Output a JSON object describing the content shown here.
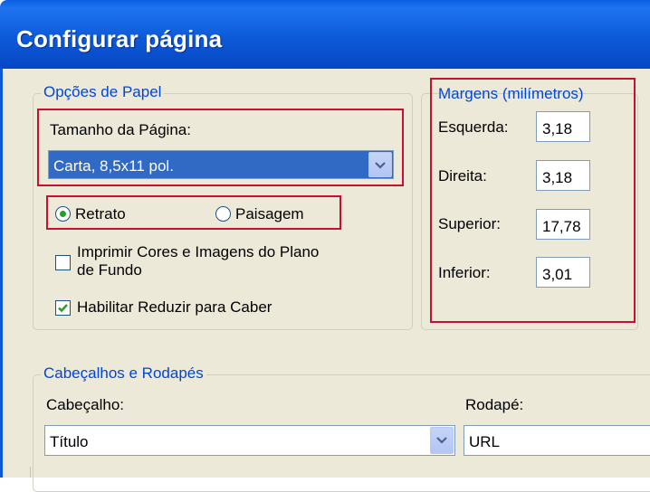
{
  "dialog": {
    "title": "Configurar página"
  },
  "paper_options": {
    "legend": "Opções de Papel",
    "page_size_label": "Tamanho da Página:",
    "page_size_value": "Carta, 8,5x11 pol.",
    "orientation": {
      "portrait_label": "Retrato",
      "landscape_label": "Paisagem",
      "selected": "Retrato"
    },
    "print_background": {
      "label_line1": "Imprimir Cores e Imagens do Plano",
      "label_line2": "de Fundo",
      "checked": false
    },
    "shrink_to_fit": {
      "label": "Habilitar Reduzir para Caber",
      "checked": true
    }
  },
  "margins": {
    "legend": "Margens (milímetros)",
    "left": {
      "label": "Esquerda:",
      "value": "3,18"
    },
    "right": {
      "label": "Direita:",
      "value": "3,18"
    },
    "top": {
      "label": "Superior:",
      "value": "17,78"
    },
    "bottom": {
      "label": "Inferior:",
      "value": "3,01"
    }
  },
  "headers_footers": {
    "legend": "Cabeçalhos e Rodapés",
    "header_label": "Cabeçalho:",
    "header_value": "Título",
    "footer_label": "Rodapé:",
    "footer_value": "URL"
  },
  "colors": {
    "title_bar": "#0d5ad8",
    "dialog_bg": "#ece9d8",
    "legend_text": "#0046d5",
    "highlight_box": "#c8102e",
    "selection": "#316ac5"
  }
}
